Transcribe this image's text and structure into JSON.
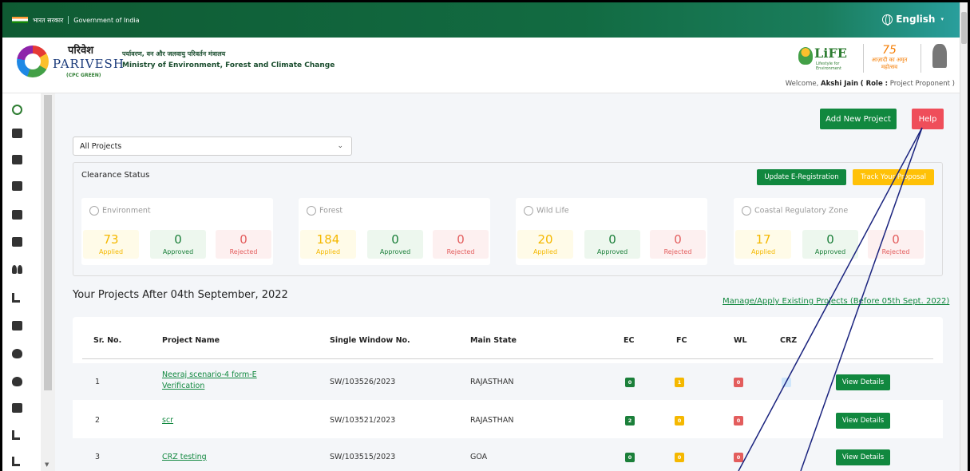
{
  "gov_bar": {
    "hindi": "भारत सरकार",
    "english": "Government of India",
    "language": "English"
  },
  "header": {
    "brand_hindi": "परिवेश",
    "brand_english": "PARIVESH",
    "brand_sub": "(CPC GREEN)",
    "ministry_hindi": "पर्यावरण, वन और जलवायु परिवर्तन मंत्रालय",
    "ministry_english": "Ministry of Environment, Forest and Climate Change",
    "life_label": "LiFE",
    "life_sub": "Lifestyle for Environment",
    "amrit_label": "75",
    "amrit_sub": "आज़ादी का अमृत महोत्सव",
    "welcome_prefix": "Welcome,",
    "user_name": "Akshi Jain",
    "role_prefix": "( Role :",
    "role": "Project Proponent )"
  },
  "actions": {
    "add_project": "Add New Project",
    "help": "Help"
  },
  "filter": {
    "selected": "All Projects"
  },
  "clearance": {
    "title": "Clearance Status",
    "update_btn": "Update E-Registration",
    "track_btn": "Track Your Proposal",
    "cards": [
      {
        "name": "Environment",
        "applied": "73",
        "approved": "0",
        "rejected": "0"
      },
      {
        "name": "Forest",
        "applied": "184",
        "approved": "0",
        "rejected": "0"
      },
      {
        "name": "Wild Life",
        "applied": "20",
        "approved": "0",
        "rejected": "0"
      },
      {
        "name": "Coastal Regulatory Zone",
        "applied": "17",
        "approved": "0",
        "rejected": "0"
      }
    ],
    "labels": {
      "applied": "Applied",
      "approved": "Approved",
      "rejected": "Rejected"
    }
  },
  "projects": {
    "title": "Your Projects After 04th September, 2022",
    "manage_link": "Manage/Apply Existing Projects (Before 05th Sept. 2022)",
    "columns": [
      "Sr. No.",
      "Project Name",
      "Single Window No.",
      "Main State",
      "EC",
      "FC",
      "WL",
      "CRZ"
    ],
    "view_label": "View Details",
    "rows": [
      {
        "sr": "1",
        "name_line1": "Neeraj scenario-4 form-E",
        "name_line2": "Verification",
        "sw": "SW/103526/2023",
        "state": "RAJASTHAN",
        "ec": "0",
        "fc": "1",
        "wl": "0"
      },
      {
        "sr": "2",
        "name_line1": "scr",
        "name_line2": "",
        "sw": "SW/103521/2023",
        "state": "RAJASTHAN",
        "ec": "2",
        "fc": "0",
        "wl": "0"
      },
      {
        "sr": "3",
        "name_line1": "CRZ testing",
        "name_line2": "",
        "sw": "SW/103515/2023",
        "state": "GOA",
        "ec": "0",
        "fc": "0",
        "wl": "0"
      }
    ]
  },
  "colors": {
    "green": "#11883f",
    "red": "#ef4e5a",
    "yellow": "#ffc107",
    "annotation": "#1a237e"
  }
}
